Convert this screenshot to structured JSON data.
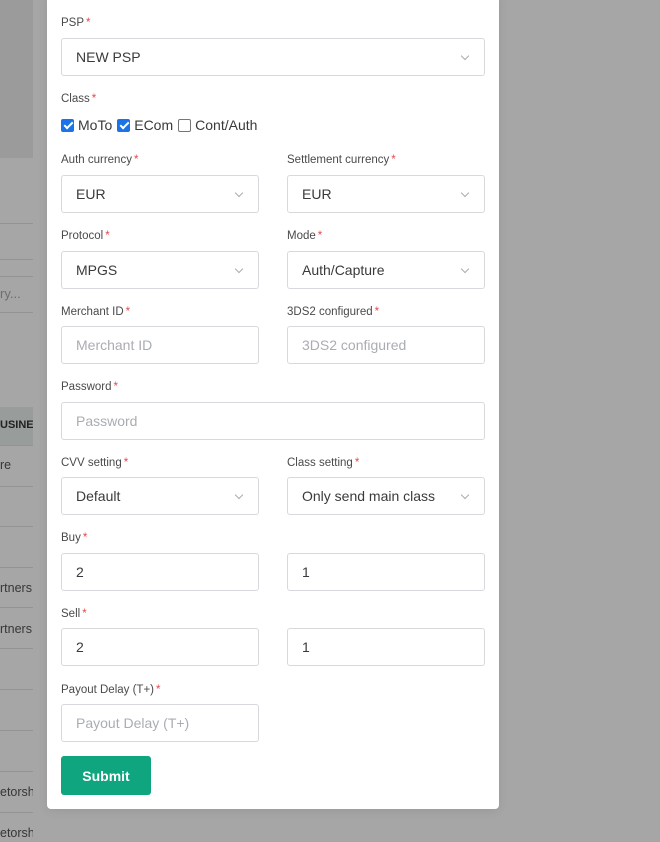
{
  "background": {
    "fragments": [
      "ry...",
      "USINES",
      "re",
      "rtners",
      "rtners",
      "etorsh",
      "etorsh"
    ]
  },
  "form": {
    "required_mark": "*",
    "psp": {
      "label": "PSP",
      "value": "NEW PSP"
    },
    "class": {
      "label": "Class",
      "options": [
        {
          "label": "MoTo",
          "checked": true
        },
        {
          "label": "ECom",
          "checked": true
        },
        {
          "label": "Cont/Auth",
          "checked": false
        }
      ]
    },
    "auth_currency": {
      "label": "Auth currency",
      "value": "EUR"
    },
    "settlement_currency": {
      "label": "Settlement currency",
      "value": "EUR"
    },
    "protocol": {
      "label": "Protocol",
      "value": "MPGS"
    },
    "mode": {
      "label": "Mode",
      "value": "Auth/Capture"
    },
    "merchant_id": {
      "label": "Merchant ID",
      "placeholder": "Merchant ID",
      "value": ""
    },
    "three_ds2": {
      "label": "3DS2 configured",
      "placeholder": "3DS2 configured",
      "value": ""
    },
    "password": {
      "label": "Password",
      "placeholder": "Password",
      "value": ""
    },
    "cvv_setting": {
      "label": "CVV setting",
      "value": "Default"
    },
    "class_setting": {
      "label": "Class setting",
      "value": "Only send main class"
    },
    "buy": {
      "label": "Buy",
      "value_1": "2",
      "value_2": "1"
    },
    "sell": {
      "label": "Sell",
      "value_1": "2",
      "value_2": "1"
    },
    "payout_delay": {
      "label": "Payout Delay (T+)",
      "placeholder": "Payout Delay (T+)",
      "value": ""
    },
    "submit_label": "Submit"
  }
}
